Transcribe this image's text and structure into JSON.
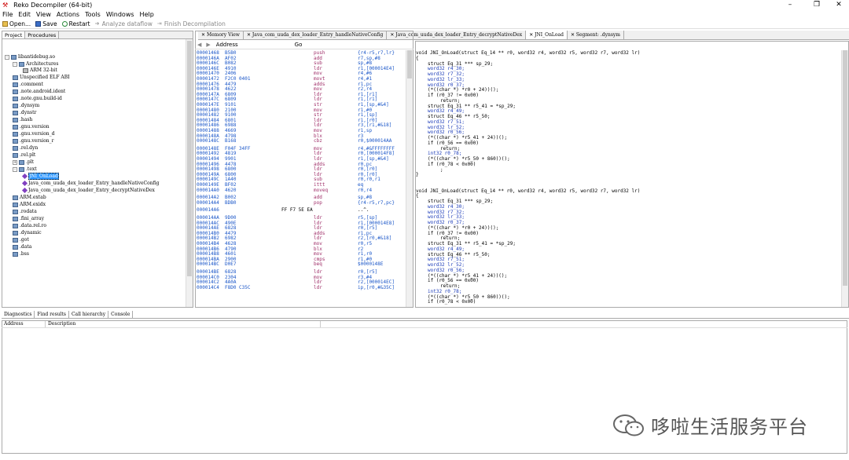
{
  "window": {
    "title": "Reko Decompiler (64-bit)",
    "minimize": "–",
    "maximize": "❐",
    "close": "✕"
  },
  "menu": [
    "File",
    "Edit",
    "View",
    "Actions",
    "Tools",
    "Windows",
    "Help"
  ],
  "toolbar": {
    "open": "Open...",
    "save": "Save",
    "restart": "Restart",
    "analyze": "Analyze dataflow",
    "finish": "Finish Decompilation"
  },
  "left_tabs": [
    "Project",
    "Procedures"
  ],
  "tree": [
    {
      "label": "libantidebug.so",
      "depth": 0,
      "exp": "-"
    },
    {
      "label": "Architectures",
      "depth": 1,
      "exp": "-"
    },
    {
      "label": "ARM 32-bit",
      "depth": 2,
      "exp": ""
    },
    {
      "label": "Unspecified ELF ABI",
      "depth": 1,
      "exp": ""
    },
    {
      "label": ".comment",
      "depth": 1,
      "exp": ""
    },
    {
      "label": ".note.android.ident",
      "depth": 1,
      "exp": ""
    },
    {
      "label": ".note.gnu.build-id",
      "depth": 1,
      "exp": ""
    },
    {
      "label": ".dynsym",
      "depth": 1,
      "exp": ""
    },
    {
      "label": ".dynstr",
      "depth": 1,
      "exp": ""
    },
    {
      "label": ".hash",
      "depth": 1,
      "exp": ""
    },
    {
      "label": ".gnu.version",
      "depth": 1,
      "exp": ""
    },
    {
      "label": ".gnu.version_d",
      "depth": 1,
      "exp": ""
    },
    {
      "label": ".gnu.version_r",
      "depth": 1,
      "exp": ""
    },
    {
      "label": ".rel.dyn",
      "depth": 1,
      "exp": ""
    },
    {
      "label": ".rel.plt",
      "depth": 1,
      "exp": ""
    },
    {
      "label": ".plt",
      "depth": 1,
      "exp": "+"
    },
    {
      "label": ".text",
      "depth": 1,
      "exp": "-"
    },
    {
      "label": "JNI_OnLoad",
      "depth": 2,
      "exp": "",
      "selected": true
    },
    {
      "label": "Java_com_uuda_dex_loader_Entry_handleNativeConfig",
      "depth": 2,
      "exp": ""
    },
    {
      "label": "Java_com_uuda_dex_loader_Entry_decryptNativeDex",
      "depth": 2,
      "exp": ""
    },
    {
      "label": "ARM.extab",
      "depth": 1,
      "exp": ""
    },
    {
      "label": "ARM.exidx",
      "depth": 1,
      "exp": ""
    },
    {
      "label": ".rodata",
      "depth": 1,
      "exp": ""
    },
    {
      "label": ".fini_array",
      "depth": 1,
      "exp": ""
    },
    {
      "label": ".data.rel.ro",
      "depth": 1,
      "exp": ""
    },
    {
      "label": ".dynamic",
      "depth": 1,
      "exp": ""
    },
    {
      "label": ".got",
      "depth": 1,
      "exp": ""
    },
    {
      "label": ".data",
      "depth": 1,
      "exp": ""
    },
    {
      "label": ".bss",
      "depth": 1,
      "exp": ""
    }
  ],
  "doc_tabs": [
    "Memory View",
    "Java_com_uuda_dex_loader_Entry_handleNativeConfig",
    "Java_com_uuda_dex_loader_Entry_decryptNativeDex",
    "JNI_OnLoad",
    "Segment: .dynsym"
  ],
  "address_bar": {
    "label": "Address",
    "go": "Go"
  },
  "disasm": [
    [
      "00001468",
      "B5B0",
      "push",
      "{r4-r5,r7,lr}"
    ],
    [
      "0000146A",
      "AF02",
      "add",
      "r7,sp,#8"
    ],
    [
      "0000146C",
      "B082",
      "sub",
      "sp,#8"
    ],
    [
      "0000146E",
      "4910",
      "ldr",
      "r1,[000014E4]"
    ],
    [
      "00001470",
      "2406",
      "mov",
      "r4,#6"
    ],
    [
      "00001472",
      "F2C0 0401",
      "movt",
      "r4,#1"
    ],
    [
      "00001476",
      "4479",
      "adds",
      "r1,pc"
    ],
    [
      "00001478",
      "4622",
      "mov",
      "r2,r4"
    ],
    [
      "0000147A",
      "6809",
      "ldr",
      "r1,[r1]"
    ],
    [
      "0000147C",
      "6809",
      "ldr",
      "r1,[r1]"
    ],
    [
      "0000147E",
      "9101",
      "str",
      "r1,[sp,#&4]"
    ],
    [
      "00001480",
      "2100",
      "mov",
      "r1,#0"
    ],
    [
      "00001482",
      "9100",
      "str",
      "r1,[sp]"
    ],
    [
      "00001484",
      "6801",
      "ldr",
      "r1,[r0]"
    ],
    [
      "00001486",
      "6988",
      "ldr",
      "r3,[r1,#&18]"
    ],
    [
      "00001488",
      "4669",
      "mov",
      "r1,sp"
    ],
    [
      "0000148A",
      "4798",
      "blx",
      "r3"
    ],
    [
      "0000148C",
      "B168",
      "cbz",
      "r0,$000014AA"
    ],
    [
      "",
      ""
    ],
    [
      "0000148E",
      "F04F 34FF",
      "mov",
      "r4,#&FFFFFFFF"
    ],
    [
      "00001492",
      "4819",
      "ldr",
      "r0,[000014F8]"
    ],
    [
      "00001494",
      "9901",
      "ldr",
      "r1,[sp,#&4]"
    ],
    [
      "00001496",
      "4478",
      "adds",
      "r0,pc"
    ],
    [
      "00001498",
      "6800",
      "ldr",
      "r0,[r0]"
    ],
    [
      "0000149A",
      "6800",
      "ldr",
      "r0,[r0]"
    ],
    [
      "0000149C",
      "1A40",
      "sub",
      "r0,r0,r1"
    ],
    [
      "0000149E",
      "BF02",
      "ittt",
      "eq"
    ],
    [
      "000014A0",
      "4620",
      "moveq",
      "r0,r4"
    ],
    [
      "",
      ""
    ],
    [
      "000014A2",
      "B002",
      "add",
      "sp,#8"
    ],
    [
      "000014A4",
      "BDB0",
      "pop",
      "{r4-r5,r7,pc}"
    ],
    [
      "",
      ""
    ],
    [
      "000014A6",
      "",
      "",
      ""
    ],
    [
      "",
      ""
    ],
    [
      "000014AA",
      "9D00",
      "ldr",
      "r5,[sp]"
    ],
    [
      "000014AC",
      "490E",
      "ldr",
      "r1,[000014E8]"
    ],
    [
      "000014AE",
      "6828",
      "ldr",
      "r0,[r5]"
    ],
    [
      "000014B0",
      "4479",
      "adds",
      "r1,pc"
    ],
    [
      "000014B2",
      "6982",
      "ldr",
      "r2,[r0,#&18]"
    ],
    [
      "000014B4",
      "4628",
      "mov",
      "r0,r5"
    ],
    [
      "000014B6",
      "4790",
      "blx",
      "r2"
    ],
    [
      "000014B8",
      "4601",
      "mov",
      "r1,r0"
    ],
    [
      "000014BA",
      "2900",
      "cmps",
      "r1,#0"
    ],
    [
      "000014BC",
      "D0E7",
      "beq",
      "$0000148E"
    ],
    [
      "",
      ""
    ],
    [
      "000014BE",
      "6828",
      "ldr",
      "r0,[r5]"
    ],
    [
      "000014C0",
      "2304",
      "mov",
      "r3,#4"
    ],
    [
      "000014C2",
      "4A0A",
      "ldr",
      "r2,[000014EC]"
    ],
    [
      "000014C4",
      "F8D0 C35C",
      "ldr",
      "ip,[r0,#&35C]"
    ]
  ],
  "raw_line": {
    "bytes": "FF F7 5E EA",
    "ascii": "..^."
  },
  "code": [
    [
      "void JNI_OnLoad(struct Eq_14 ** r0, word32 r4, word32 r5, word32 r7, word32 lr)",
      0
    ],
    [
      "{",
      0
    ],
    [
      "struct Eq_31 *** sp_29;",
      1
    ],
    [
      "word32 r4_30;",
      1
    ],
    [
      "word32 r7_32;",
      1
    ],
    [
      "word32 lr_33;",
      1
    ],
    [
      "word32 r0_37;",
      1
    ],
    [
      "(*((char *) *r0 + 24))();",
      1
    ],
    [
      "if (r0_37 != 0x00)",
      1
    ],
    [
      "return;",
      2
    ],
    [
      "struct Eq_31 ** r5_41 = *sp_29;",
      1
    ],
    [
      "word32 r4_49;",
      1
    ],
    [
      "struct Eq_46 ** r5_50;",
      1
    ],
    [
      "word32 r7_51;",
      1
    ],
    [
      "word32 lr_52;",
      1
    ],
    [
      "word32 r0_56;",
      1
    ],
    [
      "(*((char *) *r5_41 + 24))();",
      1
    ],
    [
      "if (r0_56 == 0x00)",
      1
    ],
    [
      "return;",
      2
    ],
    [
      "int32 r0_78;",
      1
    ],
    [
      "(*((char *) *r5_50 + 860))();",
      1
    ],
    [
      "if (r0_78 < 0x00)",
      1
    ],
    [
      ";",
      2
    ],
    [
      "}",
      0
    ],
    [
      "",
      0
    ],
    [
      "",
      0
    ],
    [
      "void JNI_OnLoad(struct Eq_14 ** r0, word32 r4, word32 r5, word32 r7, word32 lr)",
      0
    ],
    [
      "{",
      0
    ],
    [
      "struct Eq_31 *** sp_29;",
      1
    ],
    [
      "word32 r4_30;",
      1
    ],
    [
      "word32 r7_32;",
      1
    ],
    [
      "word32 lr_33;",
      1
    ],
    [
      "word32 r0_37;",
      1
    ],
    [
      "(*((char *) *r0 + 24))();",
      1
    ],
    [
      "if (r0_37 != 0x00)",
      1
    ],
    [
      "return;",
      2
    ],
    [
      "struct Eq_31 ** r5_41 = *sp_29;",
      1
    ],
    [
      "word32 r4_49;",
      1
    ],
    [
      "struct Eq_46 ** r5_50;",
      1
    ],
    [
      "word32 r7_51;",
      1
    ],
    [
      "word32 lr_52;",
      1
    ],
    [
      "word32 r0_56;",
      1
    ],
    [
      "(*((char *) *r5_41 + 24))();",
      1
    ],
    [
      "if (r0_56 == 0x00)",
      1
    ],
    [
      "return;",
      2
    ],
    [
      "int32 r0_78;",
      1
    ],
    [
      "(*((char *) *r5_50 + 860))();",
      1
    ],
    [
      "if (r0_78 < 0x00)",
      1
    ]
  ],
  "bottom_tabs": [
    "Diagnostics",
    "Find results",
    "Call hierarchy",
    "Console"
  ],
  "diag_columns": [
    "Address",
    "Description"
  ],
  "watermark": "哆啦生活服务平台"
}
